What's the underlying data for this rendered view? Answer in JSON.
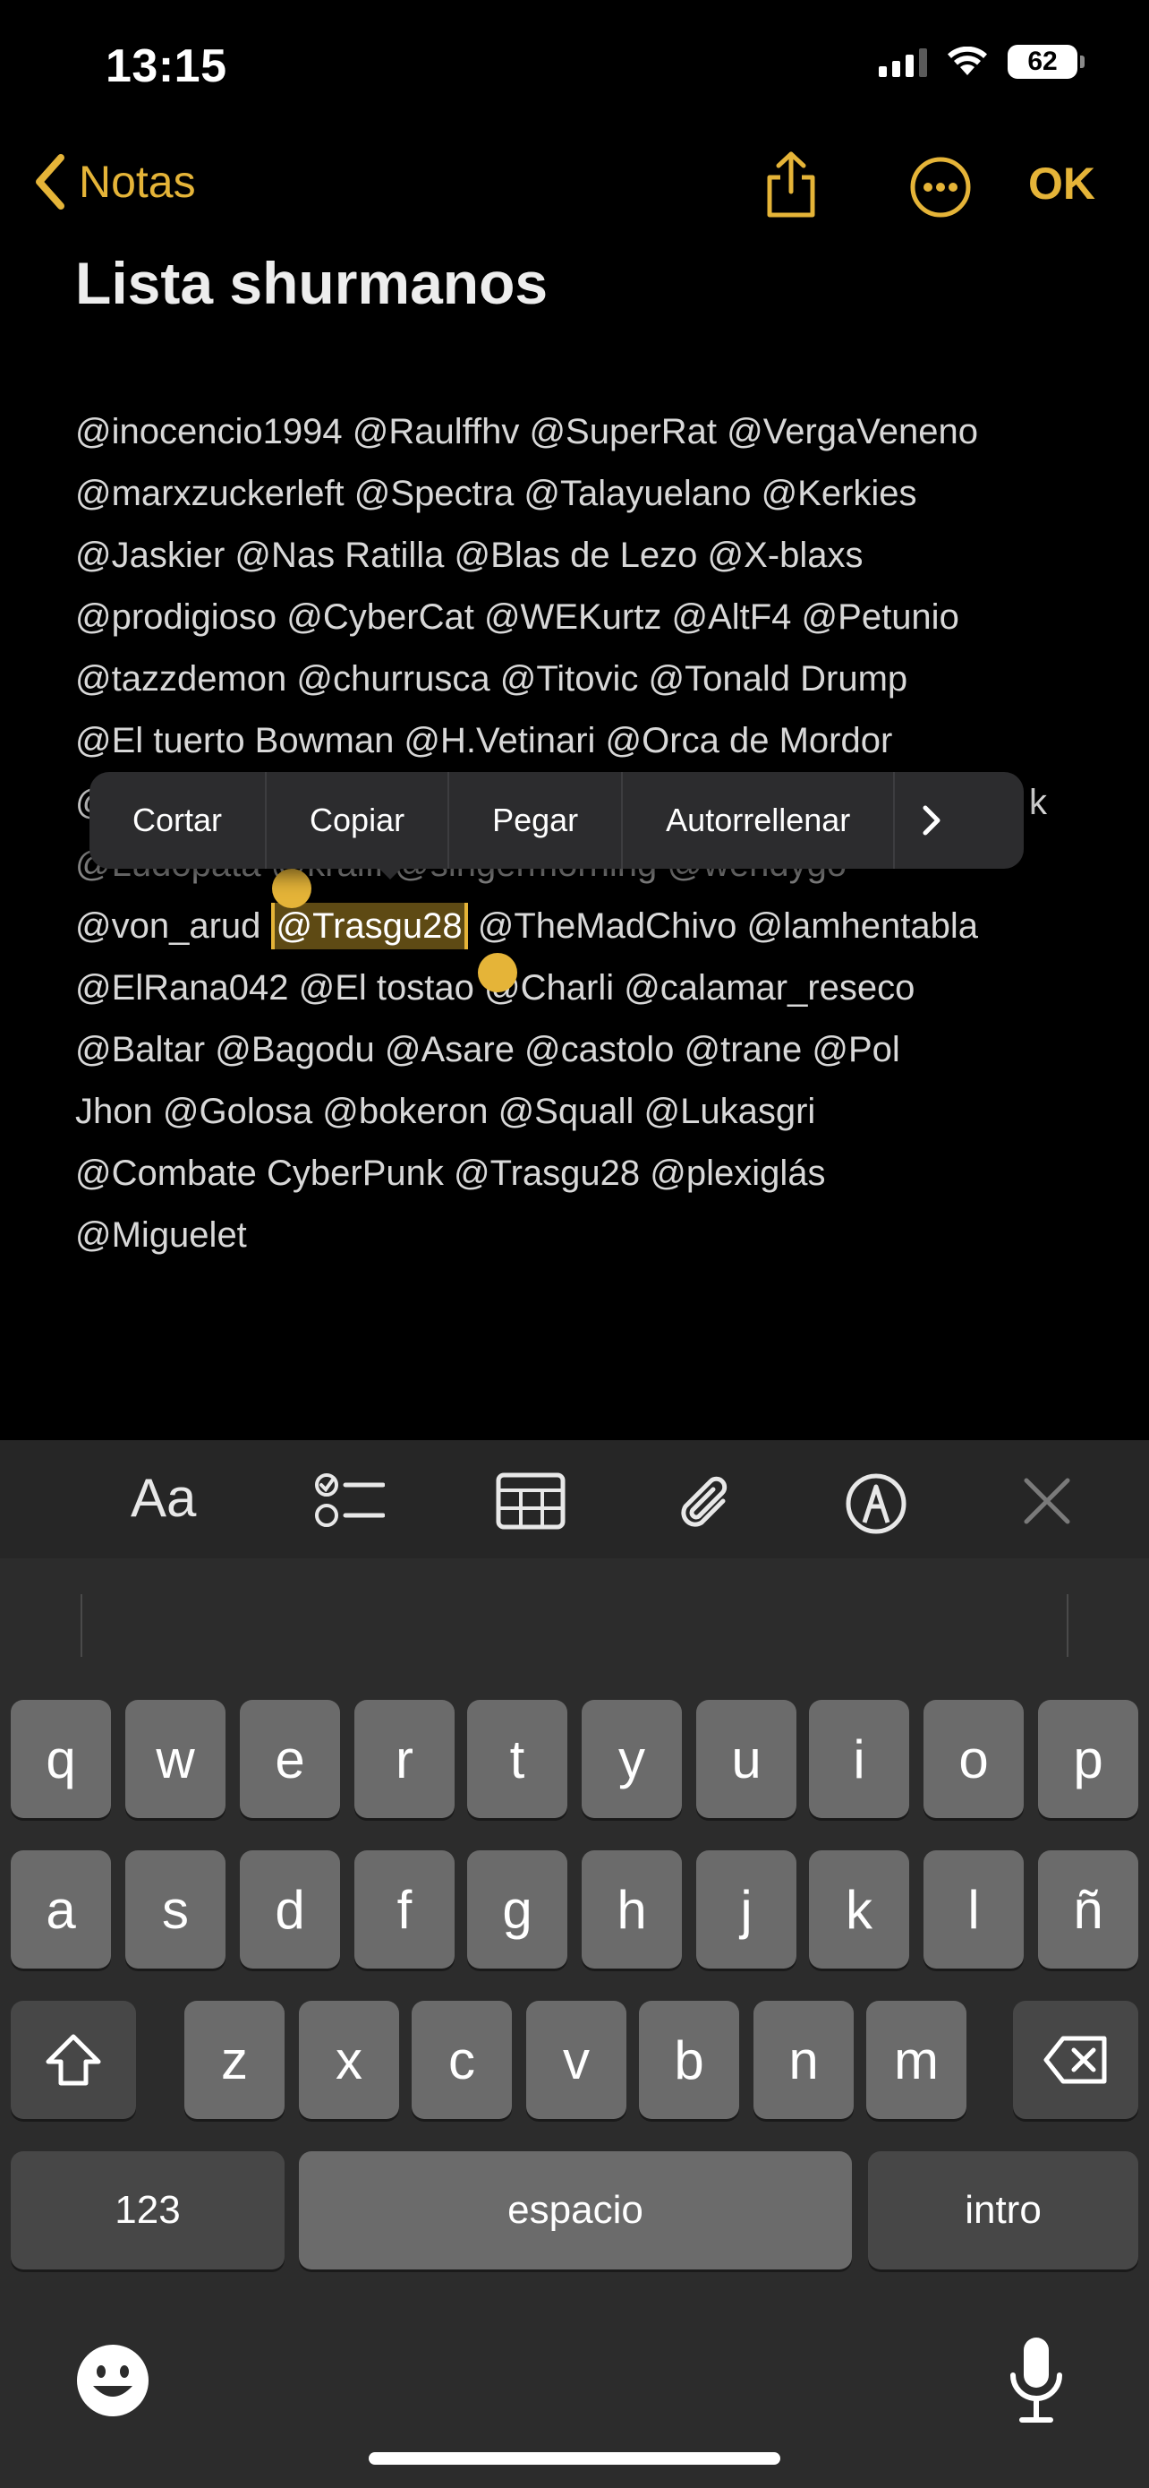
{
  "status": {
    "time": "13:15",
    "battery": "62"
  },
  "nav": {
    "back_label": "Notas",
    "ok_label": "OK"
  },
  "note": {
    "title": "Lista shurmanos",
    "lines": [
      "@inocencio1994 @Raulffhv @SuperRat @VergaVeneno",
      "@marxzuckerleft @Spectra @Talayuelano @Kerkies",
      "@Jaskier @Nas Ratilla @Blas de Lezo @X-blaxs",
      "@prodigioso @CyberCat @WEKurtz @AltF4 @Petunio",
      "@tazzdemon @churrusca @Titovic @Tonald Drump",
      "@El tuerto Bowman @H.Vetinari @Orca de Mordor",
      "@",
      "@Ludopata @kraiff @singermorning @wendygo"
    ],
    "line_8_before": "@von_arud ",
    "line_8_selected": "@Trasgu28",
    "line_8_after": " @TheMadChivo @lamhentabla",
    "lines_after": [
      "@ElRana042 @El tostao @Charli @calamar_reseco",
      "@Baltar @Bagodu @Asare @castolo @trane @Pol",
      "Jhon @Golosa @bokeron @Squall @Lukasgri",
      "@Combate CyberPunk @Trasgu28 @plexiglás",
      "@Miguelet"
    ],
    "line_7_tail": "k"
  },
  "context_menu": {
    "cut": "Cortar",
    "copy": "Copiar",
    "paste": "Pegar",
    "autofill": "Autorrellenar",
    "more": "›"
  },
  "toolbar": {
    "format": "Aa"
  },
  "keyboard": {
    "row1": [
      "q",
      "w",
      "e",
      "r",
      "t",
      "y",
      "u",
      "i",
      "o",
      "p"
    ],
    "row2": [
      "a",
      "s",
      "d",
      "f",
      "g",
      "h",
      "j",
      "k",
      "l",
      "ñ"
    ],
    "row3": [
      "z",
      "x",
      "c",
      "v",
      "b",
      "n",
      "m"
    ],
    "numbers": "123",
    "space": "espacio",
    "return": "intro"
  },
  "colors": {
    "accent": "#e5b438",
    "background": "#000000",
    "keyboard": "#2c2c2c"
  }
}
